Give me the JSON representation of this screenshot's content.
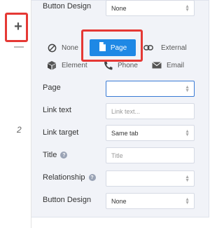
{
  "rows": {
    "button_design_top": {
      "label": "Button Design",
      "value": "None"
    },
    "page": {
      "label": "Page",
      "value": ""
    },
    "link_text": {
      "label": "Link text",
      "placeholder": "Link text..."
    },
    "link_target": {
      "label": "Link target",
      "value": "Same tab"
    },
    "title": {
      "label": "Title",
      "placeholder": "Title"
    },
    "relationship": {
      "label": "Relationship",
      "value": ""
    },
    "button_design": {
      "label": "Button Design",
      "value": "None"
    }
  },
  "link_types": {
    "none": "None",
    "page": "Page",
    "external": "External",
    "element": "Element",
    "phone": "Phone",
    "email": "Email"
  },
  "row_number": "2",
  "add_symbol": "+",
  "colors": {
    "accent": "#1e88e5",
    "highlight": "#e53935"
  }
}
